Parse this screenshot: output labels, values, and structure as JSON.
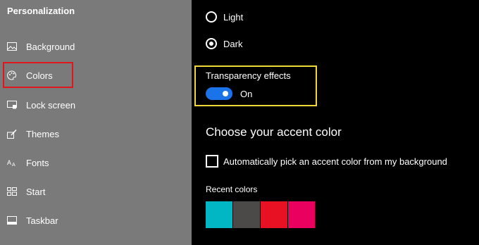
{
  "sidebar": {
    "title": "Personalization",
    "items": [
      {
        "name": "background",
        "label": "Background",
        "icon": "picture-icon"
      },
      {
        "name": "colors",
        "label": "Colors",
        "icon": "palette-icon"
      },
      {
        "name": "lock-screen",
        "label": "Lock screen",
        "icon": "lock-screen-icon"
      },
      {
        "name": "themes",
        "label": "Themes",
        "icon": "brush-icon"
      },
      {
        "name": "fonts",
        "label": "Fonts",
        "icon": "font-icon"
      },
      {
        "name": "start",
        "label": "Start",
        "icon": "start-grid-icon"
      },
      {
        "name": "taskbar",
        "label": "Taskbar",
        "icon": "taskbar-icon"
      }
    ],
    "selected": "Colors",
    "selected_outline_color": "#e0161d"
  },
  "mode": {
    "options": [
      {
        "label": "Light",
        "checked": false
      },
      {
        "label": "Dark",
        "checked": true
      }
    ]
  },
  "transparency": {
    "title": "Transparency effects",
    "state": "On",
    "enabled": true,
    "toggle_color": "#1a73e8",
    "outline_color": "#f0d83b"
  },
  "accent": {
    "heading": "Choose your accent color",
    "auto_pick_label": "Automatically pick an accent color from my background",
    "auto_pick_checked": false,
    "recent_label": "Recent colors",
    "recent_colors": [
      "#00b7c3",
      "#4c4a48",
      "#e81123",
      "#ea005e"
    ]
  }
}
